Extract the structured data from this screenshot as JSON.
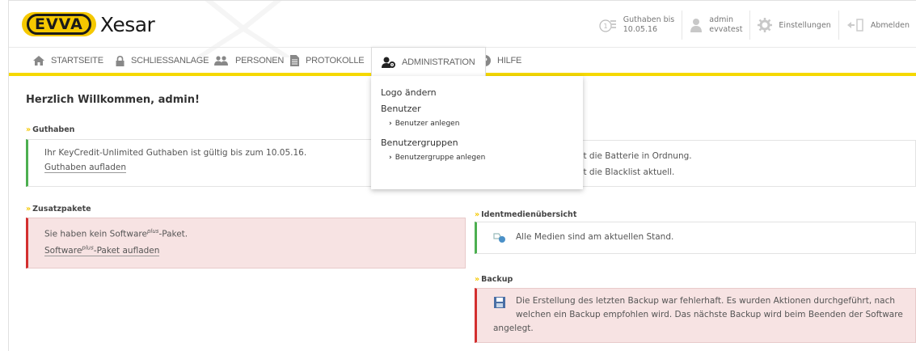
{
  "header": {
    "brand": "EVVA",
    "product": "Xesar",
    "credit_line1": "Guthaben bis",
    "credit_line2": "10.05.16",
    "user_name": "admin",
    "user_site": "evvatest",
    "settings_label": "Einstellungen",
    "logout_label": "Abmelden"
  },
  "nav": {
    "items": [
      {
        "label": "STARTSEITE",
        "icon": "home-icon"
      },
      {
        "label": "SCHLIESSANLAGE",
        "icon": "lock-icon"
      },
      {
        "label": "PERSONEN",
        "icon": "people-icon"
      },
      {
        "label": "PROTOKOLLE",
        "icon": "document-icon"
      },
      {
        "label": "ADMINISTRATION",
        "icon": "admin-icon"
      },
      {
        "label": "HILFE",
        "icon": "help-icon"
      }
    ],
    "active": "ADMINISTRATION"
  },
  "dropdown": {
    "logo": "Logo ändern",
    "benutzer": "Benutzer",
    "benutzer_anlegen": "Benutzer anlegen",
    "gruppen": "Benutzergruppen",
    "gruppe_anlegen": "Benutzergruppe anlegen"
  },
  "main": {
    "welcome": "Herzlich Willkommen, admin!",
    "guthaben": {
      "title": "Guthaben",
      "text": "Ihr KeyCredit-Unlimited Guthaben ist gültig bis zum 10.05.16.",
      "link": "Guthaben aufladen"
    },
    "zusatz": {
      "title": "Zusatzpakete",
      "text_pre": "Sie haben kein Software",
      "text_sup": "plus",
      "text_post": "-Paket.",
      "link_pre": "Software",
      "link_sup": "plus",
      "link_post": "-Paket aufladen"
    },
    "status": {
      "line1": "st die Batterie in Ordnung.",
      "line2": "st die Blacklist aktuell."
    },
    "ident": {
      "title": "Identmedienübersicht",
      "text": "Alle Medien sind am aktuellen Stand."
    },
    "backup": {
      "title": "Backup",
      "line1": "Die Erstellung des letzten Backup war fehlerhaft. Es wurden Aktionen durchgeführt, nach",
      "line2": "welchen ein Backup empfohlen wird. Das nächste Backup wird beim Beenden der Software",
      "line3": "angelegt."
    }
  },
  "colors": {
    "accent_yellow": "#f5d800",
    "ok_green": "#4caf50",
    "error_red": "#d32f2f",
    "error_bg": "#f7e3e3"
  }
}
